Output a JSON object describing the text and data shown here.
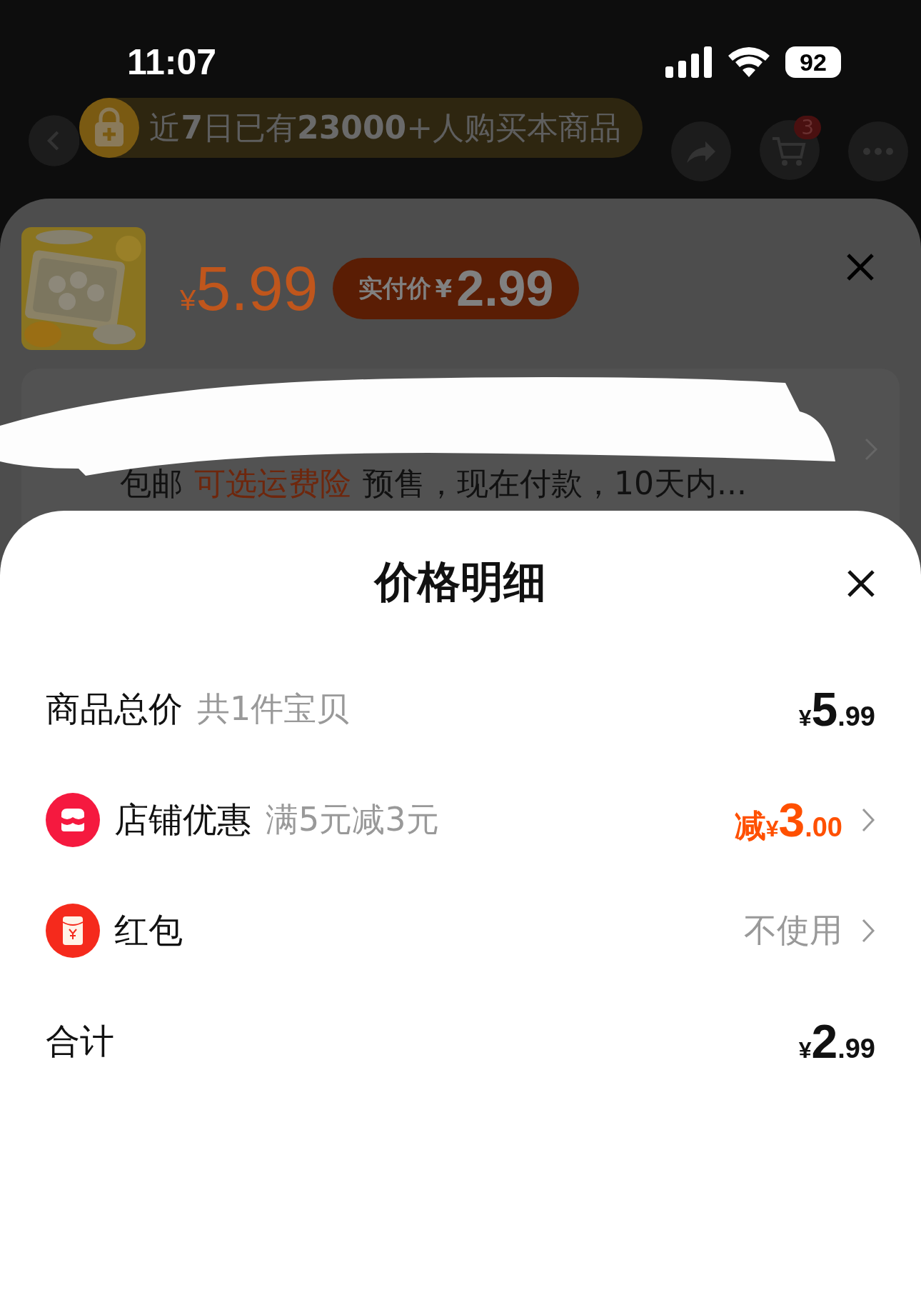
{
  "status_bar": {
    "time": "11:07",
    "battery": "92"
  },
  "banner": {
    "text": "近**7**日已有**23000**+人购买本商品"
  },
  "nav": {
    "cart_badge": "3"
  },
  "product_sheet": {
    "price_symbol": "¥",
    "price": "5.99",
    "badge_label": "实付价",
    "badge_symbol": "¥",
    "badge_price": "2.99",
    "info_tags": [
      {
        "text": "包邮",
        "highlight": false
      },
      {
        "text": "可选运费险",
        "highlight": true
      }
    ],
    "info_text": "预售，现在付款，10天内..."
  },
  "price_detail": {
    "title": "价格明细",
    "rows": [
      {
        "kind": "plain",
        "label": "商品总价",
        "note": "共1件宝贝",
        "value": {
          "kind": "amount",
          "symbol": "¥",
          "integer": "5",
          "decimal": ".99",
          "highlight": false
        },
        "chevron": false
      },
      {
        "kind": "shop",
        "label": "店铺优惠",
        "note": "满5元减3元",
        "value": {
          "kind": "amount",
          "prefix": "减",
          "symbol": "¥",
          "integer": "3",
          "decimal": ".00",
          "highlight": true
        },
        "chevron": true
      },
      {
        "kind": "envelope",
        "label": "红包",
        "value": {
          "kind": "text",
          "text": "不使用"
        },
        "chevron": true
      },
      {
        "kind": "plain",
        "label": "合计",
        "value": {
          "kind": "amount",
          "symbol": "¥",
          "integer": "2",
          "decimal": ".99",
          "highlight": false
        },
        "chevron": false
      }
    ]
  }
}
